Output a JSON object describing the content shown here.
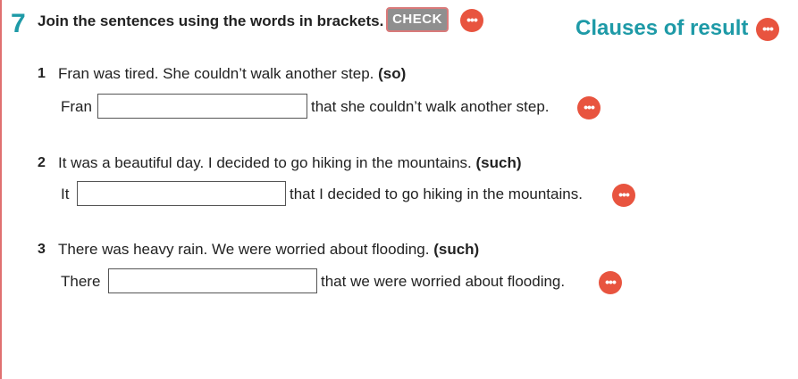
{
  "exercise": {
    "number": "7",
    "instruction": "Join the sentences using the words in brackets.",
    "check_label": "CHECK",
    "topic": "Clauses of result"
  },
  "items": [
    {
      "number": "1",
      "sentence": "Fran was tired. She couldn’t walk another step.",
      "keyword": "(so)",
      "lead": "Fran",
      "answer": "",
      "tail": "that she couldn’t walk another step."
    },
    {
      "number": "2",
      "sentence": "It was a beautiful day. I decided to go hiking in the mountains.",
      "keyword": "(such)",
      "lead": "It",
      "answer": "",
      "tail": "that I decided to go hiking in the mountains."
    },
    {
      "number": "3",
      "sentence": "There was heavy rain. We were worried about flooding.",
      "keyword": "(such)",
      "lead": "There",
      "answer": "",
      "tail": "that we were worried about flooding."
    }
  ],
  "icons": {
    "more": "more-options-icon",
    "more_glyph": "•••"
  },
  "colors": {
    "accent": "#1e9aa7",
    "more_button": "#e8543f",
    "check_button": "#8f8f8f"
  }
}
